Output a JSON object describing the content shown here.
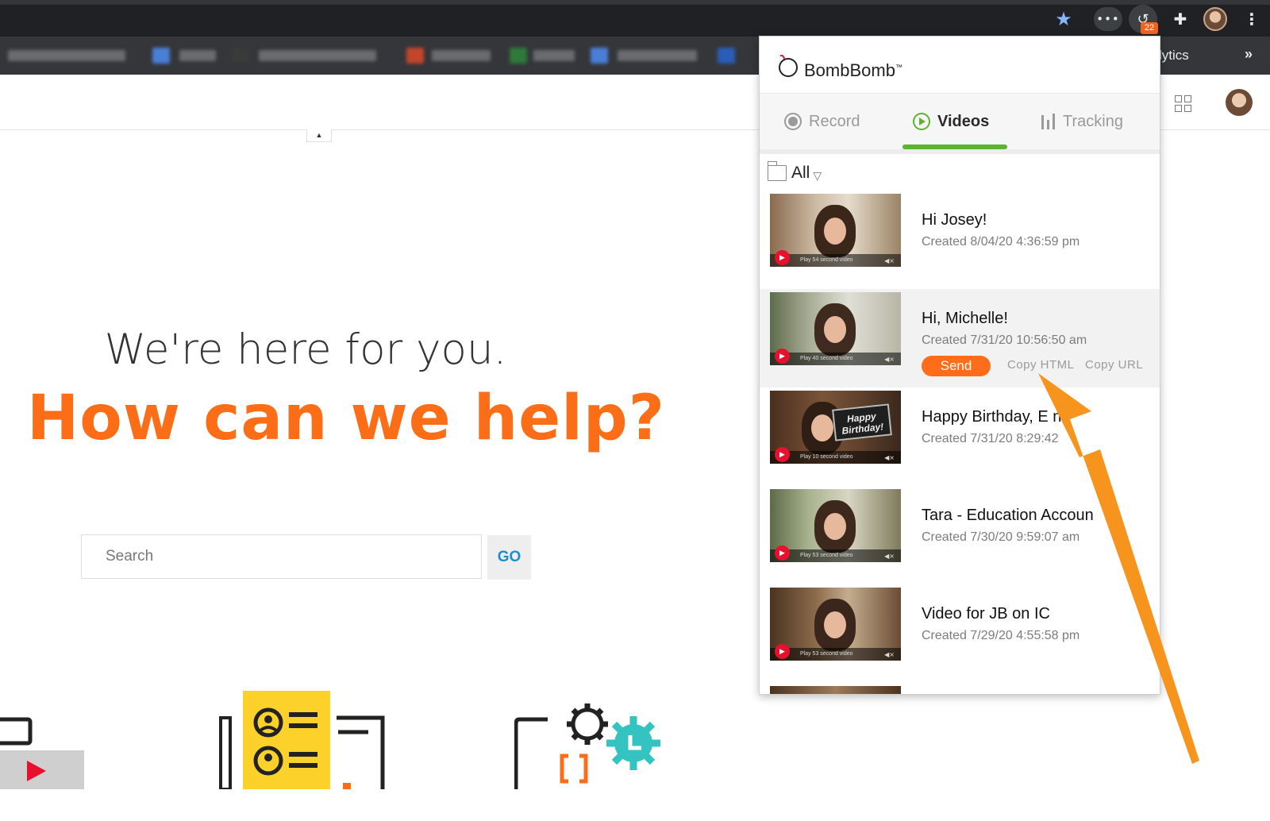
{
  "browser": {
    "badge_count": "22",
    "bookmark_right_text": "lytics",
    "bookmark_overflow": "»"
  },
  "page": {
    "hero_line1": "We're here for you.",
    "hero_line2": "How can we help?",
    "search": {
      "placeholder": "Search",
      "value": ""
    },
    "go_label": "GO",
    "brand_color": "#fb6d17"
  },
  "extension": {
    "brand_name": "BombBomb",
    "trademark": "™",
    "tabs": [
      {
        "label": "Record",
        "icon": "record-icon",
        "active": false
      },
      {
        "label": "Videos",
        "icon": "play-circle-icon",
        "active": true
      },
      {
        "label": "Tracking",
        "icon": "bar-chart-icon",
        "active": false
      }
    ],
    "folder_filter": "All",
    "accent_color": "#5cb330",
    "send_color": "#ff6d1a",
    "videos": [
      {
        "title": "Hi Josey!",
        "created": "Created 8/04/20 4:36:59 pm",
        "thumb_caption": "Play 54 second video"
      },
      {
        "title": "Hi, Michelle!",
        "created": "Created 7/31/20 10:56:50 am",
        "thumb_caption": "Play 40 second video"
      },
      {
        "title": "Happy Birthday, E   n!",
        "created": "Created 7/31/20 8:29:42",
        "thumb_caption": "Play 10 second video",
        "thumb_sign": "Happy Birthday!"
      },
      {
        "title": "Tara - Education Accoun",
        "created": "Created 7/30/20 9:59:07 am",
        "thumb_caption": "Play 53 second video"
      },
      {
        "title": "Video for JB on IC",
        "created": "Created 7/29/20 4:55:58 pm",
        "thumb_caption": "Play 53 second video"
      }
    ],
    "actions": {
      "send": "Send",
      "copy_html": "Copy HTML",
      "copy_url": "Copy URL"
    }
  }
}
